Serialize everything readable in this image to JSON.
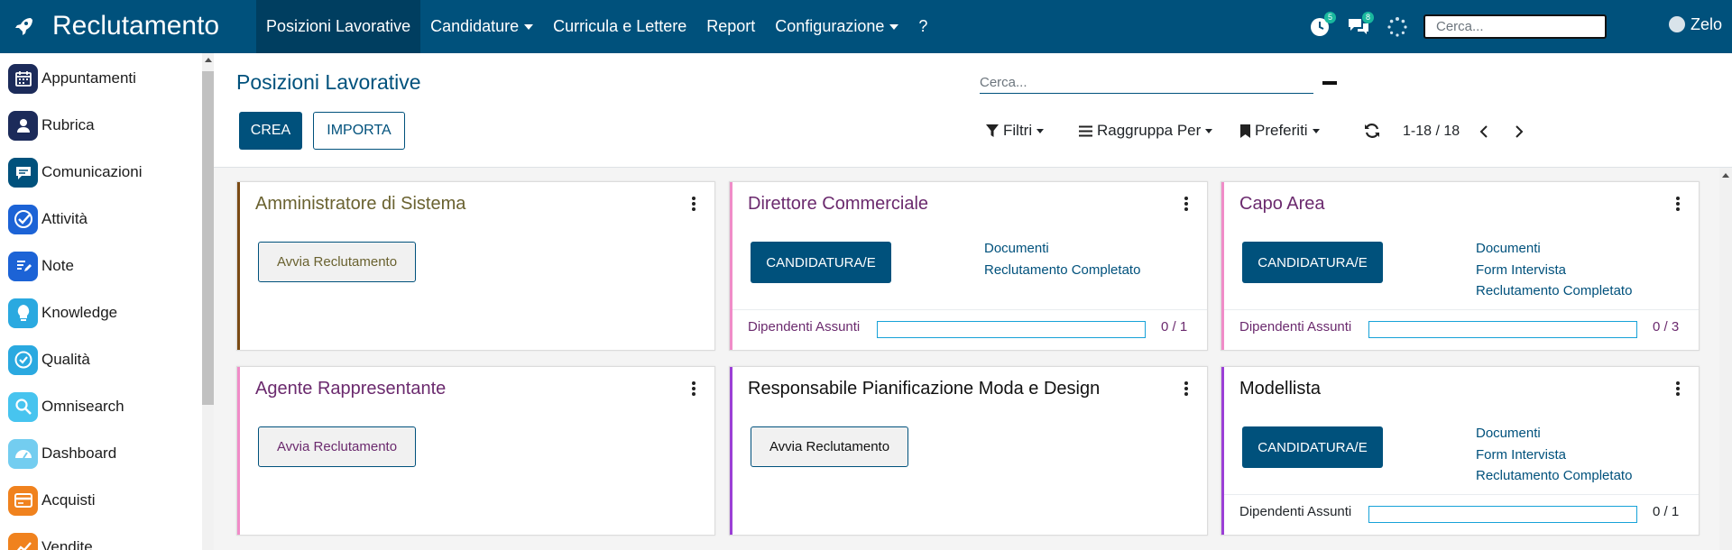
{
  "app": {
    "title": "Reclutamento",
    "brand_icon": "rocket-icon",
    "user_name": "Zelo"
  },
  "topmenu": {
    "items": [
      {
        "label": "Posizioni Lavorative",
        "dropdown": false,
        "active": true
      },
      {
        "label": "Candidature",
        "dropdown": true,
        "active": false
      },
      {
        "label": "Curricula e Lettere",
        "dropdown": false,
        "active": false
      },
      {
        "label": "Report",
        "dropdown": false,
        "active": false
      },
      {
        "label": "Configurazione",
        "dropdown": true,
        "active": false
      },
      {
        "label": "?",
        "dropdown": false,
        "active": false
      }
    ],
    "activity_badge": "5",
    "messages_badge": "8",
    "search_placeholder": "Cerca..."
  },
  "sidebar": {
    "items": [
      {
        "label": "Appuntamenti",
        "icon": "calendar-icon",
        "color": "#1c2b5a"
      },
      {
        "label": "Rubrica",
        "icon": "contacts-icon",
        "color": "#1c2b5a"
      },
      {
        "label": "Comunicazioni",
        "icon": "chat-icon",
        "color": "#00517c"
      },
      {
        "label": "Attività",
        "icon": "check-circle-icon",
        "color": "#1c63d6"
      },
      {
        "label": "Note",
        "icon": "note-icon",
        "color": "#1c63d6"
      },
      {
        "label": "Knowledge",
        "icon": "bulb-icon",
        "color": "#2aa9e0"
      },
      {
        "label": "Qualità",
        "icon": "quality-icon",
        "color": "#2aa9e0"
      },
      {
        "label": "Omnisearch",
        "icon": "search-icon",
        "color": "#47c4ef"
      },
      {
        "label": "Dashboard",
        "icon": "gauge-icon",
        "color": "#73cdf0"
      },
      {
        "label": "Acquisti",
        "icon": "card-icon",
        "color": "#f0821e"
      },
      {
        "label": "Vendite",
        "icon": "chart-icon",
        "color": "#f0821e"
      }
    ]
  },
  "controls": {
    "page_title": "Posizioni Lavorative",
    "create_label": "CREA",
    "import_label": "IMPORTA",
    "search_placeholder": "Cerca...",
    "filters_label": "Filtri",
    "groupby_label": "Raggruppa Per",
    "favorites_label": "Preferiti",
    "pager_value": "1-18 / 18"
  },
  "cards": [
    {
      "title": "Amministratore di Sistema",
      "color": "#7a4a14",
      "title_color": "#6a6230",
      "action": "Avvia Reclutamento",
      "action_type": "avvia",
      "links": [],
      "footer_label": "",
      "hired": null,
      "target": null,
      "progress_value": ""
    },
    {
      "title": "Direttore Commerciale",
      "color": "#f08cc8",
      "title_color": "#6b2a6e",
      "action": "CANDIDATURA/E",
      "action_type": "candidature",
      "links": [
        "Documenti",
        "Reclutamento Completato"
      ],
      "footer_label": "Dipendenti Assunti",
      "hired": 0,
      "target": 1,
      "progress_value": "0 / 1"
    },
    {
      "title": "Capo Area",
      "color": "#f08cc8",
      "title_color": "#6b2a6e",
      "action": "CANDIDATURA/E",
      "action_type": "candidature",
      "links": [
        "Documenti",
        "Form Intervista",
        "Reclutamento Completato"
      ],
      "footer_label": "Dipendenti Assunti",
      "hired": 0,
      "target": 3,
      "progress_value": "0 / 3"
    },
    {
      "title": "Agente Rappresentante",
      "color": "#f08cc8",
      "title_color": "#6b2a6e",
      "action": "Avvia Reclutamento",
      "action_type": "avvia",
      "links": [],
      "footer_label": "",
      "hired": null,
      "target": null,
      "progress_value": ""
    },
    {
      "title": "Responsabile Pianificazione Moda e Design",
      "color": "#9b3fd6",
      "title_color": "#111111",
      "action": "Avvia Reclutamento",
      "action_type": "avvia",
      "links": [],
      "footer_label": "",
      "hired": null,
      "target": null,
      "progress_value": ""
    },
    {
      "title": "Modellista",
      "color": "#9b3fd6",
      "title_color": "#111111",
      "action": "CANDIDATURA/E",
      "action_type": "candidature",
      "links": [
        "Documenti",
        "Form Intervista",
        "Reclutamento Completato"
      ],
      "footer_label": "Dipendenti Assunti",
      "hired": 0,
      "target": 1,
      "progress_value": "0 / 1"
    }
  ]
}
